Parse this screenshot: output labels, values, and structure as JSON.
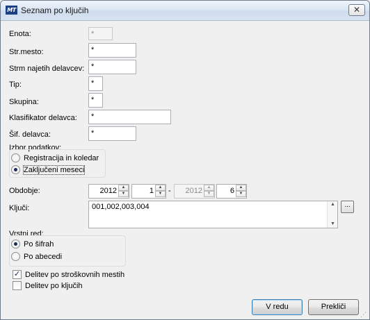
{
  "window": {
    "title": "Seznam po ključih",
    "app_icon_label": "MT",
    "close_glyph": "✕"
  },
  "fields": {
    "enota": {
      "label": "Enota:",
      "value": "*"
    },
    "str_mesto": {
      "label": "Str.mesto:",
      "value": "*"
    },
    "strm_najetih": {
      "label": "Strm najetih delavcev:",
      "value": "*"
    },
    "tip": {
      "label": "Tip:",
      "value": "*"
    },
    "skupina": {
      "label": "Skupina:",
      "value": "*"
    },
    "klasifikator": {
      "label": "Klasifikator delavca:",
      "value": "*"
    },
    "sif_delavca": {
      "label": "Šif. delavca:",
      "value": "*"
    }
  },
  "izbor": {
    "label": "Izbor podatkov:",
    "options": [
      {
        "label": "Registracija in koledar",
        "checked": false
      },
      {
        "label": "Zaključeni meseci",
        "checked": true
      }
    ]
  },
  "obdobje": {
    "label": "Obdobje:",
    "from_year": "2012",
    "from_month": "1",
    "separator": "-",
    "to_year": "2012",
    "to_month": "6",
    "up_glyph": "▲",
    "down_glyph": "▼"
  },
  "kljuci": {
    "label": "Ključi:",
    "value": "001,002,003,004",
    "browse_label": "..."
  },
  "vrstni_red": {
    "label": "Vrstni red:",
    "options": [
      {
        "label": "Po šifrah",
        "checked": true
      },
      {
        "label": "Po abecedi",
        "checked": false
      }
    ]
  },
  "checkboxes": [
    {
      "label": "Delitev po stroškovnih mestih",
      "checked": true
    },
    {
      "label": "Delitev po ključih",
      "checked": false
    }
  ],
  "buttons": {
    "ok": "V redu",
    "cancel": "Prekliči"
  },
  "check_glyph": "✓"
}
